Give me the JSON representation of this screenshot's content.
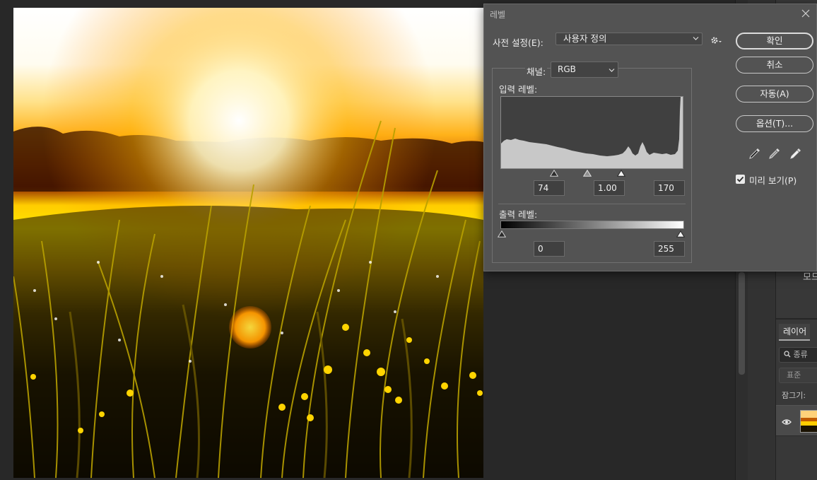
{
  "dialog": {
    "title": "레벨",
    "preset_label": "사전 설정(E):",
    "preset_value": "사용자 정의",
    "channel_label": "채널:",
    "channel_value": "RGB",
    "input_levels_label": "입력 레벨:",
    "input_black": "74",
    "input_gamma": "1.00",
    "input_white": "170",
    "output_levels_label": "출력 레벨:",
    "output_black": "0",
    "output_white": "255",
    "buttons": {
      "ok": "확인",
      "cancel": "취소",
      "auto": "자동(A)",
      "options": "옵션(T)..."
    },
    "preview_label": "미리 보기(P)",
    "preview_checked": true
  },
  "right_panel": {
    "mode_label_partial": "모드",
    "layers_tab": "레이어",
    "filter_placeholder": "종류",
    "blend_mode": "표준",
    "lock_label": "잠그기:"
  },
  "icons": {
    "close": "close-icon",
    "gear": "gear-icon",
    "chevron": "chevron-down-icon",
    "eyedropper_black": "black-eyedropper-icon",
    "eyedropper_gray": "gray-eyedropper-icon",
    "eyedropper_white": "white-eyedropper-icon",
    "eye": "eye-icon",
    "search": "search-icon"
  },
  "colors": {
    "dialog_bg": "#535353",
    "workspace_bg": "#282828",
    "histogram_fill": "#c8c8c8"
  }
}
